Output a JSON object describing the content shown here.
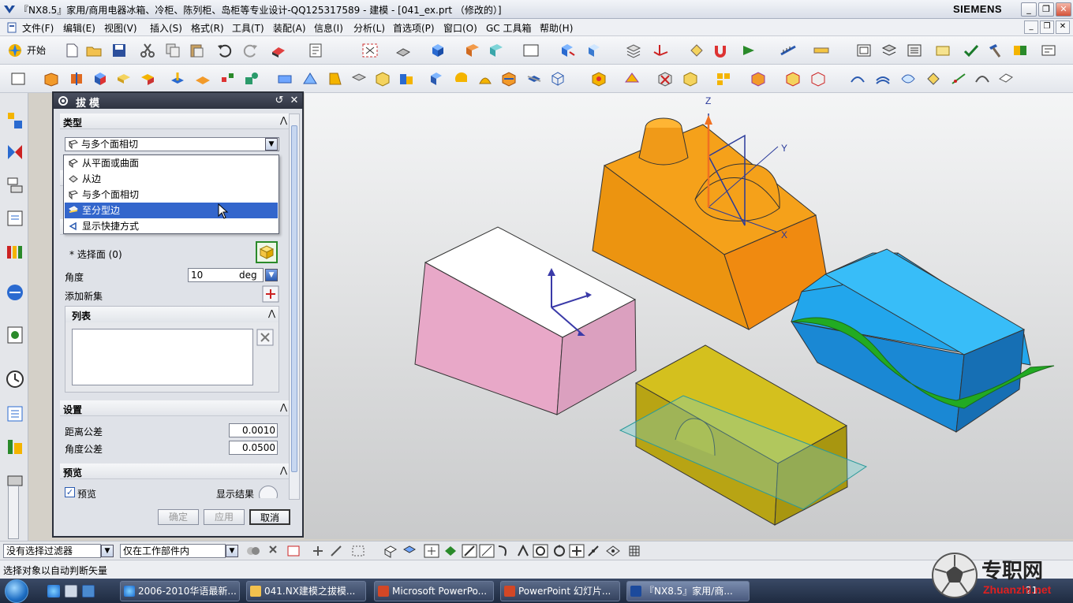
{
  "window": {
    "title": "『NX8.5』家用/商用电器冰箱、冷柜、陈列柜、岛柜等专业设计-QQ125317589 - 建模 - [041_ex.prt （修改的）]",
    "brand": "SIEMENS",
    "controls": [
      "_",
      "❐",
      "✕"
    ]
  },
  "menu": {
    "items": [
      "文件(F)",
      "编辑(E)",
      "视图(V)",
      "插入(S)",
      "格式(R)",
      "工具(T)",
      "装配(A)",
      "信息(I)",
      "分析(L)",
      "首选项(P)",
      "窗口(O)",
      "GC 工具箱",
      "帮助(H)"
    ],
    "doc_controls": [
      "_",
      "❐",
      "✕"
    ]
  },
  "toolbar": {
    "start_label": "开始"
  },
  "dialog": {
    "title": "拔模",
    "header_icons": [
      "↺",
      "✕"
    ],
    "sections": {
      "type": "类型",
      "settings": "设置",
      "preview": "预览"
    },
    "type_value": "与多个面相切",
    "dropdown_options": [
      {
        "label": "从平面或曲面",
        "selected": false
      },
      {
        "label": "从边",
        "selected": false
      },
      {
        "label": "与多个面相切",
        "selected": false
      },
      {
        "label": "至分型边",
        "selected": true
      },
      {
        "label": "显示快捷方式",
        "selected": false
      }
    ],
    "select_face_label": "* 选择面 (0)",
    "angle_label": "角度",
    "angle_value": "10",
    "angle_unit": "deg",
    "add_new_set_label": "添加新集",
    "list_label": "列表",
    "distance_tol_label": "距离公差",
    "distance_tol_value": "0.0010",
    "angle_tol_label": "角度公差",
    "angle_tol_value": "0.0500",
    "preview_checkbox_label": "预览",
    "show_result_label": "显示结果",
    "buttons": {
      "ok": "确定",
      "apply": "应用",
      "cancel": "取消"
    }
  },
  "viewport": {
    "axis_labels": {
      "z": "Z",
      "y": "Y",
      "x": "X"
    }
  },
  "selection_bar": {
    "filter_value": "没有选择过滤器",
    "scope_value": "仅在工作部件内"
  },
  "status": {
    "text": "选择对象以自动判断矢量"
  },
  "taskbar": {
    "tasks": [
      {
        "label": "2006-2010华语最新...",
        "active": false
      },
      {
        "label": "041.NX建模之拔模...",
        "active": false
      },
      {
        "label": "Microsoft PowerPo...",
        "active": false
      },
      {
        "label": "PowerPoint 幻灯片...",
        "active": false
      },
      {
        "label": "『NX8.5』家用/商...",
        "active": true
      }
    ],
    "clock": "21:"
  },
  "watermark": {
    "text": "专职网",
    "url": "Zhuanzhi.net"
  },
  "colors": {
    "title_bar": "#d9dee8",
    "dialog_header": "#2e3340",
    "dropdown_selected": "#3366cc",
    "orange_body": "#f5a11a",
    "pink_body": "#e8a8c8",
    "blue_body": "#22a6ec",
    "yellow_body": "#c8b416",
    "green_surface": "#22aa22",
    "cyan_plane": "#6fd5d5"
  }
}
